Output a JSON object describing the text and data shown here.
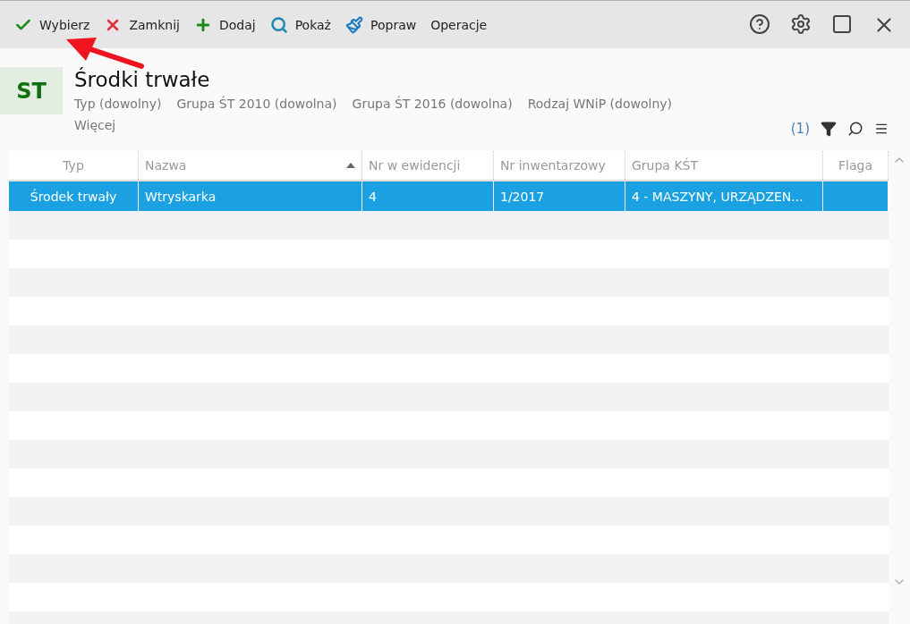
{
  "toolbar": {
    "actions": [
      {
        "kind": "check",
        "label": "Wybierz"
      },
      {
        "kind": "close",
        "label": "Zamknij"
      },
      {
        "kind": "add",
        "label": "Dodaj"
      },
      {
        "kind": "show",
        "label": "Pokaż"
      },
      {
        "kind": "edit",
        "label": "Popraw"
      },
      {
        "kind": "none",
        "label": "Operacje"
      }
    ]
  },
  "header": {
    "badge": "ST",
    "title": "Środki trwałe",
    "filters": [
      "Typ (dowolny)",
      "Grupa ŚT 2010 (dowolna)",
      "Grupa ŚT 2016 (dowolna)",
      "Rodzaj WNiP (dowolny)"
    ],
    "more": "Więcej",
    "count": "(1)"
  },
  "table": {
    "columns": [
      {
        "label": "Typ",
        "sorted": false
      },
      {
        "label": "Nazwa",
        "sorted": true
      },
      {
        "label": "Nr w ewidencji",
        "sorted": false
      },
      {
        "label": "Nr inwentarzowy",
        "sorted": false
      },
      {
        "label": "Grupa KŚT",
        "sorted": false
      },
      {
        "label": "Flaga",
        "sorted": false
      }
    ],
    "rows": [
      {
        "selected": true,
        "cells": [
          "Środek trwały",
          "Wtryskarka",
          "4",
          "1/2017",
          "4 - MASZYNY, URZĄDZEN...",
          ""
        ]
      }
    ]
  }
}
